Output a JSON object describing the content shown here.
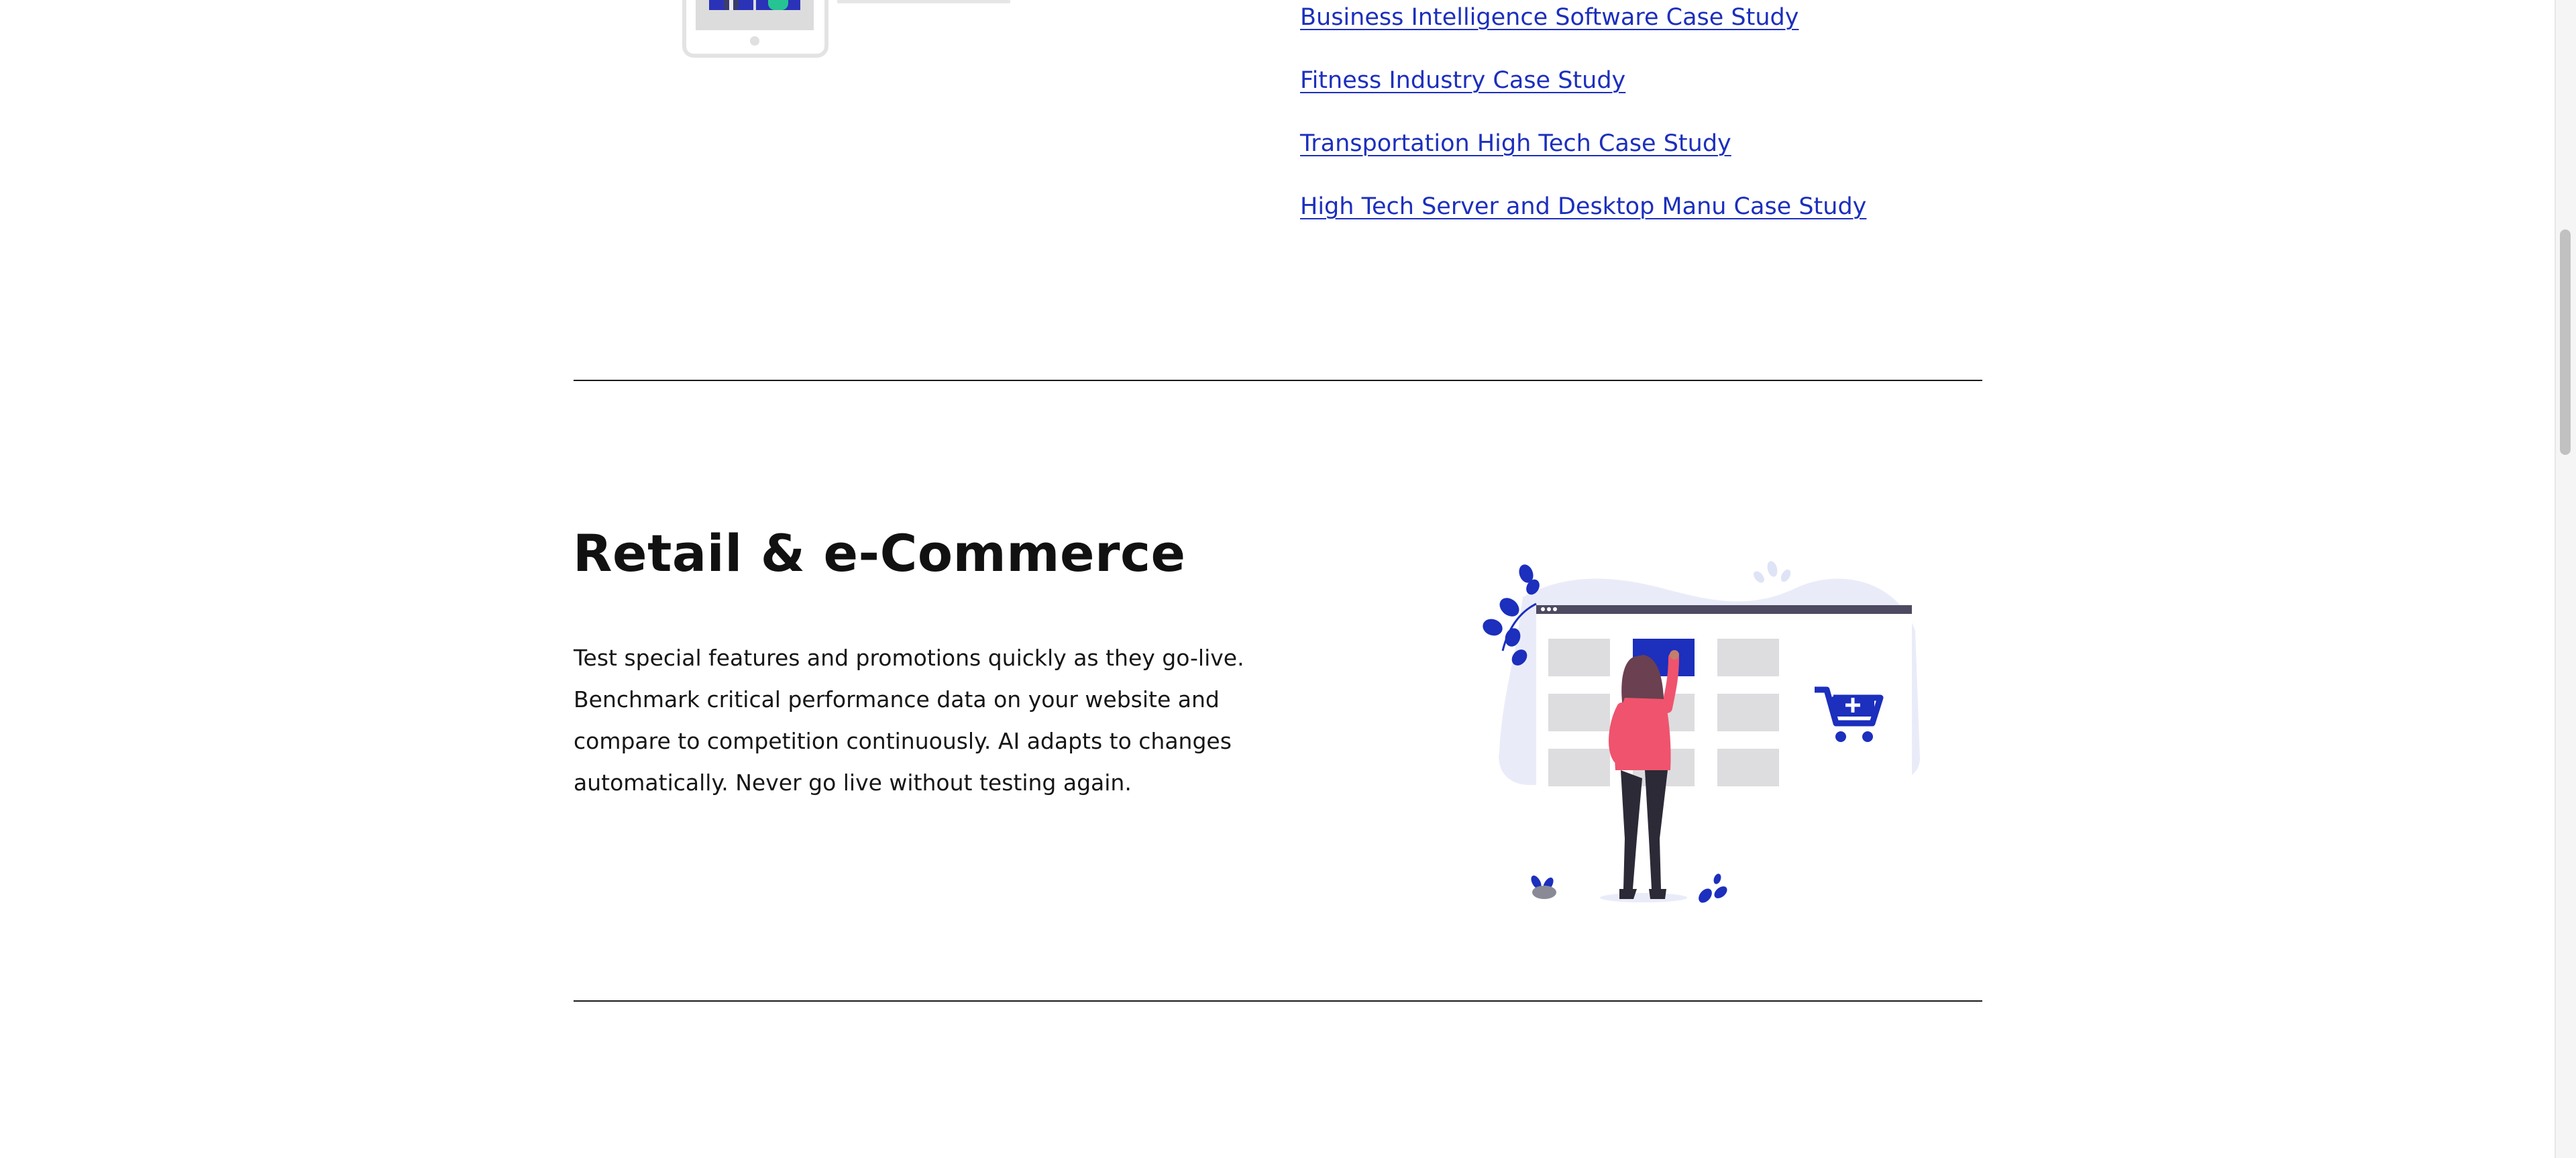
{
  "case_studies": {
    "links": [
      "Business Intelligence Software Case Study",
      "Fitness Industry Case Study",
      "Transportation High Tech Case Study",
      "High Tech Server and Desktop Manu Case Study"
    ]
  },
  "retail_section": {
    "title": "Retail & e-Commerce",
    "description_lines": [
      "Test special features and promotions quickly as they go-live.",
      "Benchmark critical performance data on your website and",
      "compare to competition continuously. AI adapts to changes",
      "automatically. Never go live without testing again."
    ]
  },
  "illustrations": {
    "top": "tablet-video-call-illustration",
    "retail": "woman-shopping-grid-cart-illustration"
  },
  "colors": {
    "link": "#1c2fbd",
    "accent_blue": "#1c2fbd",
    "person_pink": "#f0536d",
    "divider": "#1a1a1a",
    "text": "#161616"
  }
}
